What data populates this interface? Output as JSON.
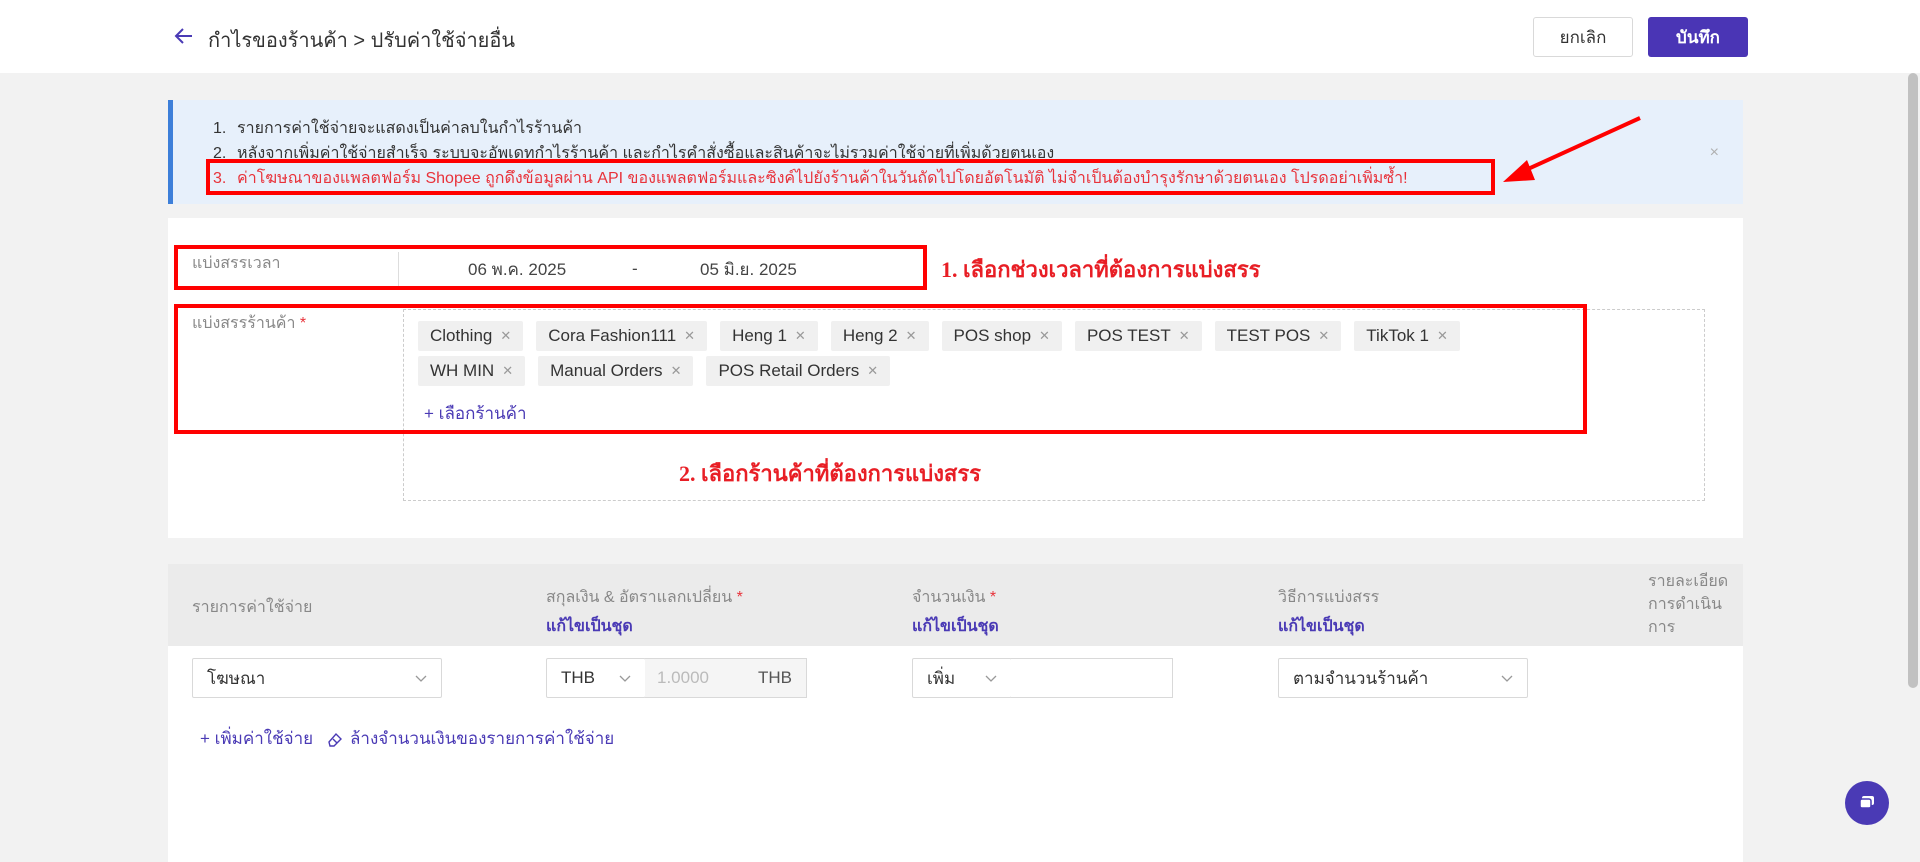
{
  "header": {
    "title": "กำไรของร้านค้า > ปรับค่าใช้จ่ายอื่น",
    "cancel_label": "ยกเลิก",
    "save_label": "บันทึก"
  },
  "notice": {
    "items": [
      {
        "num": "1.",
        "text": "รายการค่าใช้จ่ายจะแสดงเป็นค่าลบในกำไรร้านค้า"
      },
      {
        "num": "2.",
        "text": "หลังจากเพิ่มค่าใช้จ่ายสำเร็จ ระบบจะอัพเดทกำไรร้านค้า และกำไรคำสั่งซื้อและสินค้าจะไม่รวมค่าใช้จ่ายที่เพิ่มด้วยตนเอง"
      },
      {
        "num": "3.",
        "text": "ค่าโฆษณาของแพลตฟอร์ม Shopee ถูกดึงข้อมูลผ่าน API ของแพลตฟอร์มและซิงค์ไปยังร้านค้าในวันถัดไปโดยอัตโนมัติ ไม่จำเป็นต้องบำรุงรักษาด้วยตนเอง โปรดอย่าเพิ่มซ้ำ!"
      }
    ],
    "close": "×"
  },
  "allocation": {
    "time_label": "แบ่งสรรเวลา",
    "date_start": "06 พ.ค. 2025",
    "date_sep": "-",
    "date_end": "05 มิ.ย. 2025",
    "shop_label": "แบ่งสรรร้านค้า",
    "required_mark": "*",
    "shops": [
      "Clothing",
      "Cora Fashion111",
      "Heng 1",
      "Heng 2",
      "POS shop",
      "POS TEST",
      "TEST POS",
      "TikTok 1",
      "WH MIN",
      "Manual Orders",
      "POS Retail Orders"
    ],
    "add_shop": "+ เลือกร้านค้า"
  },
  "annotations": {
    "step1": "1. เลือกช่วงเวลาที่ต้องการแบ่งสรร",
    "step2": "2. เลือกร้านค้าที่ต้องการแบ่งสรร"
  },
  "table": {
    "col_item": "รายการค่าใช้จ่าย",
    "col_currency": "สกุลเงิน & อัตราแลกเปลี่ยน",
    "col_amount": "จำนวนเงิน",
    "col_method": "วิธีการแบ่งสรร",
    "col_detail_1": "รายละเอียด",
    "col_detail_2": "การดำเนิน",
    "col_detail_3": "การ",
    "batch_edit": "แก้ไขเป็นชุด",
    "row": {
      "item": "โฆษณา",
      "currency": "THB",
      "rate": "1.0000",
      "rate_currency": "THB",
      "amount_type": "เพิ่ม",
      "amount": "",
      "method": "ตามจำนวนร้านค้า"
    },
    "add_expense": "+ เพิ่มค่าใช้จ่าย",
    "clear_amount": "ล้างจำนวนเงินของรายการค่าใช้จ่าย"
  },
  "colors": {
    "accent": "#4a35b5",
    "highlight": "#ff0000",
    "notice_bg": "#e7f0fb"
  }
}
